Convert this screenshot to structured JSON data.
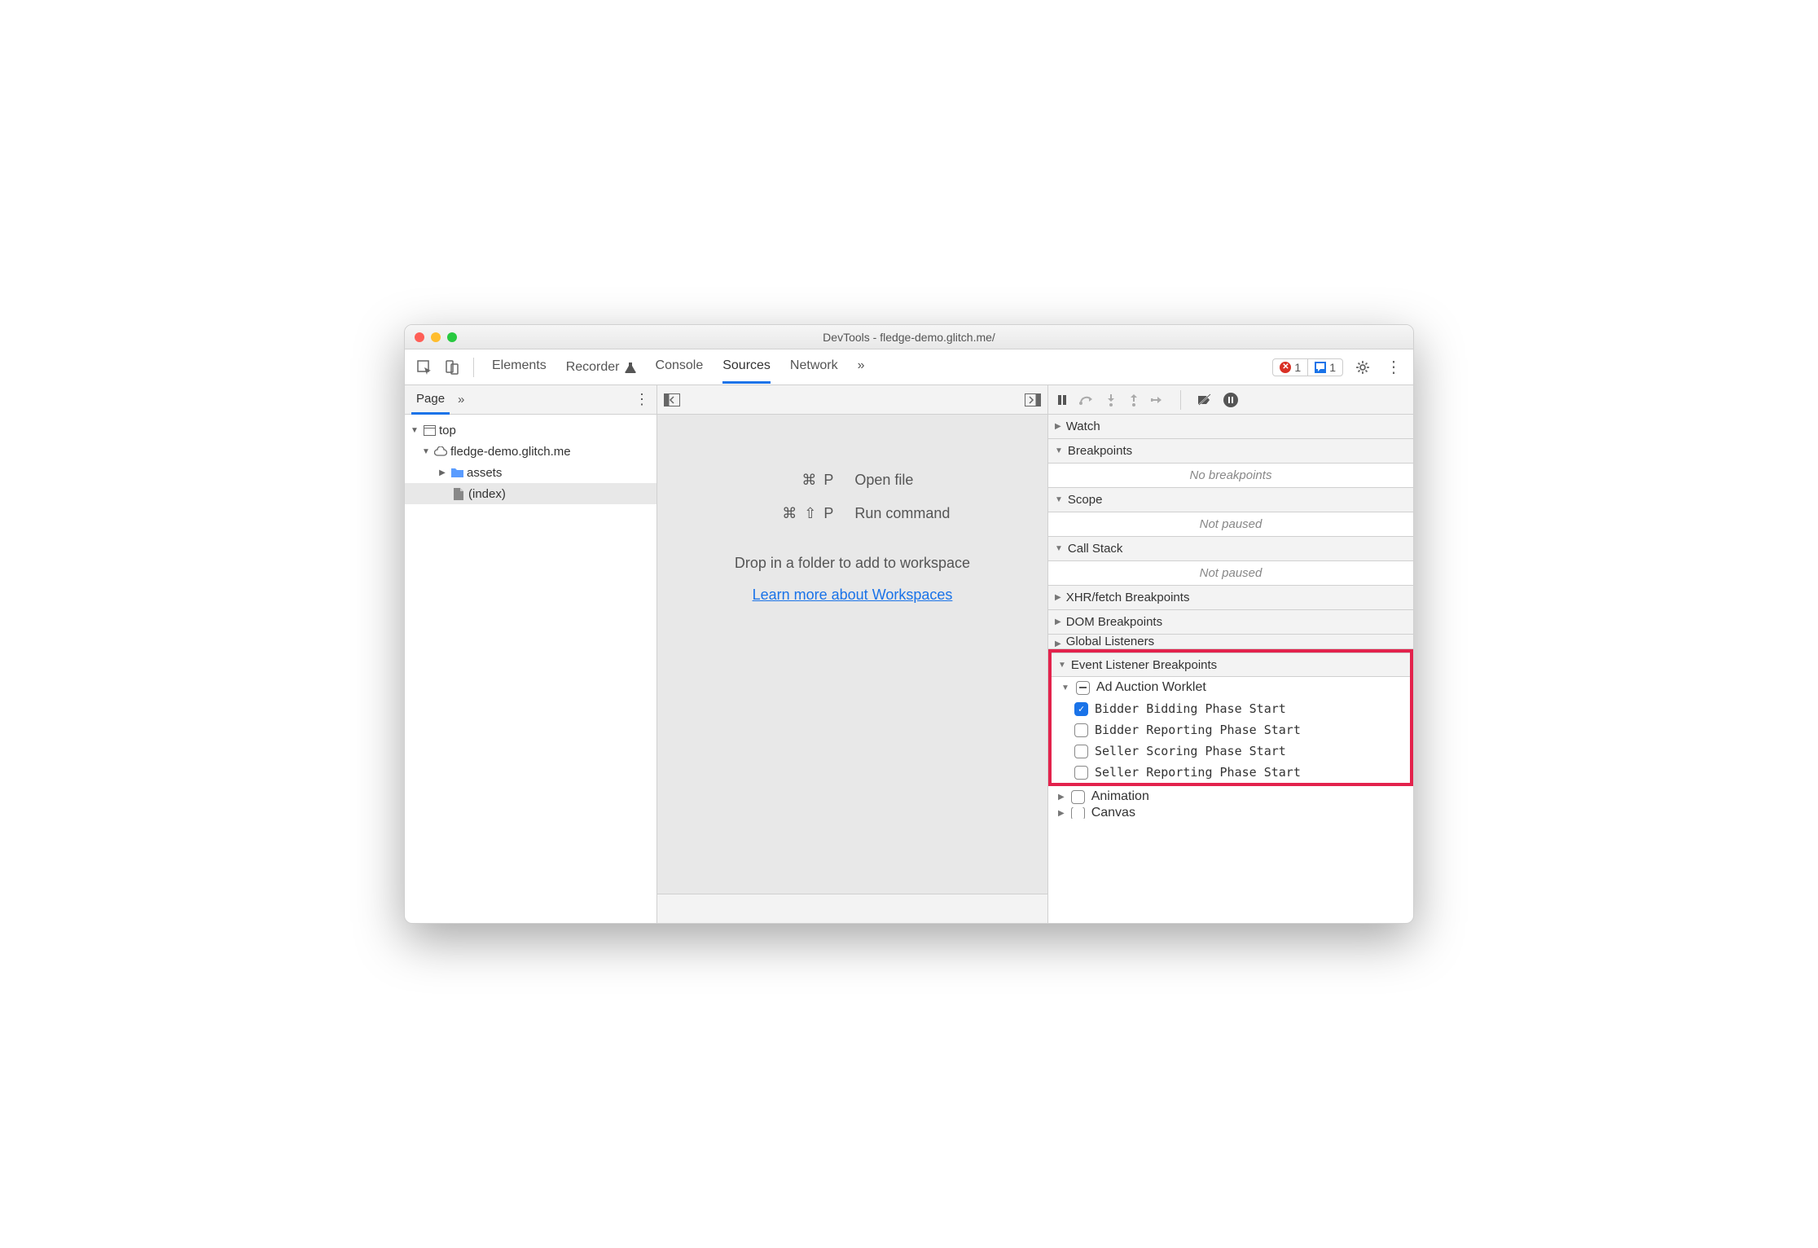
{
  "window": {
    "title": "DevTools - fledge-demo.glitch.me/"
  },
  "toolbar": {
    "tabs": [
      "Elements",
      "Recorder",
      "Console",
      "Sources",
      "Network"
    ],
    "active_tab": "Sources",
    "error_count": "1",
    "message_count": "1"
  },
  "left_pane": {
    "tab_label": "Page",
    "tree": {
      "top": "top",
      "origin": "fledge-demo.glitch.me",
      "folder": "assets",
      "file": "(index)"
    }
  },
  "middle": {
    "shortcut1_keys": "⌘ P",
    "shortcut1_label": "Open file",
    "shortcut2_keys": "⌘ ⇧ P",
    "shortcut2_label": "Run command",
    "drop_text": "Drop in a folder to add to workspace",
    "link_text": "Learn more about Workspaces"
  },
  "right_pane": {
    "sections": {
      "watch": "Watch",
      "breakpoints": "Breakpoints",
      "breakpoints_empty": "No breakpoints",
      "scope": "Scope",
      "scope_empty": "Not paused",
      "callstack": "Call Stack",
      "callstack_empty": "Not paused",
      "xhr": "XHR/fetch Breakpoints",
      "dom": "DOM Breakpoints",
      "global": "Global Listeners",
      "event_listener": "Event Listener Breakpoints",
      "ad_auction": "Ad Auction Worklet",
      "evt1": "Bidder Bidding Phase Start",
      "evt2": "Bidder Reporting Phase Start",
      "evt3": "Seller Scoring Phase Start",
      "evt4": "Seller Reporting Phase Start",
      "animation": "Animation",
      "canvas": "Canvas"
    }
  }
}
